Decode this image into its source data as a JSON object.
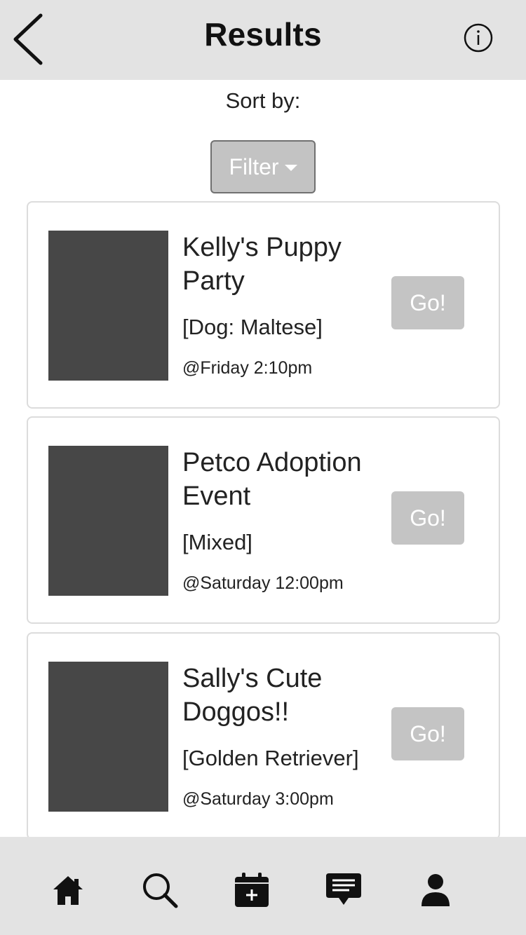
{
  "header": {
    "title": "Results",
    "back_icon": "chevron-left-icon",
    "info_icon": "info-circle-icon"
  },
  "sort": {
    "label": "Sort by:",
    "filter_label": "Filter"
  },
  "results": [
    {
      "title": "Kelly's Puppy Party",
      "breed": "[Dog: Maltese]",
      "time": "@Friday 2:10pm",
      "button": "Go!"
    },
    {
      "title": "Petco Adoption Event",
      "breed": "[Mixed]",
      "time": "@Saturday 12:00pm",
      "button": "Go!"
    },
    {
      "title": "Sally's Cute Doggos!!",
      "breed": "[Golden Retriever]",
      "time": "@Saturday 3:00pm",
      "button": "Go!"
    }
  ],
  "tabbar": {
    "items": [
      "home-icon",
      "search-icon",
      "calendar-add-icon",
      "chat-icon",
      "profile-icon"
    ]
  },
  "colors": {
    "header_bg": "#e3e3e3",
    "thumb": "#474747",
    "button_bg": "#c4c4c4"
  }
}
